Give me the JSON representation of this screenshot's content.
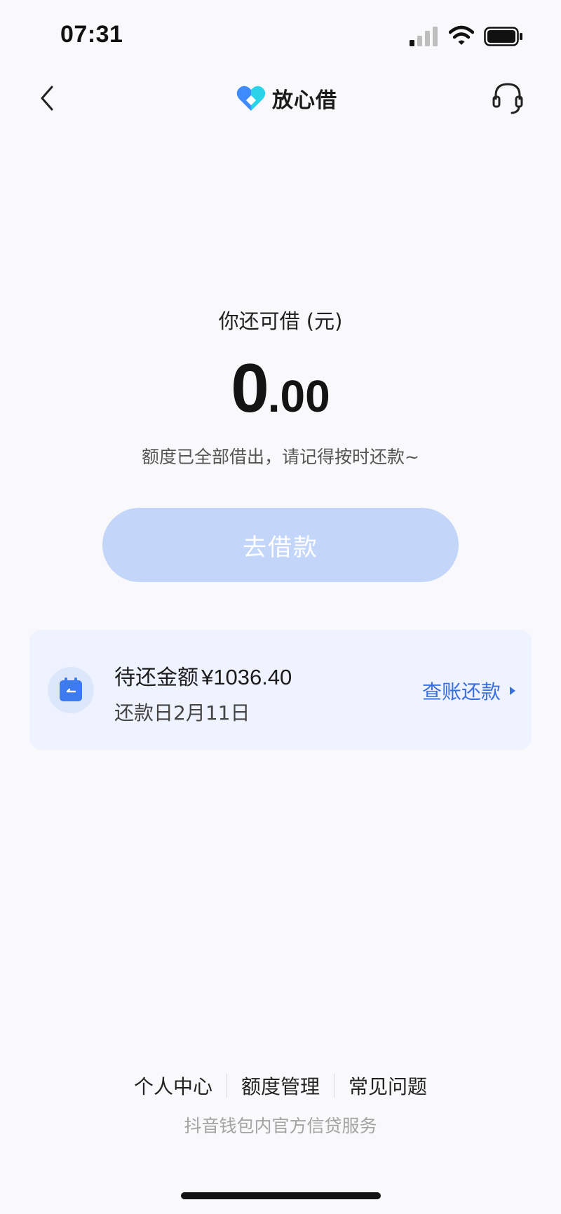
{
  "status_bar": {
    "time": "07:31",
    "icons": [
      "signal-icon",
      "wifi-icon",
      "battery-icon"
    ]
  },
  "nav": {
    "back_icon": "chevron-left-icon",
    "brand_name": "放心借",
    "service_icon": "headset-icon"
  },
  "main": {
    "available_label": "你还可借 (元)",
    "available_integer": "0",
    "available_decimal": ".00",
    "hint": "额度已全部借出，请记得按时还款~",
    "borrow_button": "去借款"
  },
  "repay": {
    "title": "待还金额",
    "amount": "¥1036.40",
    "due_date": "还款日2月11日",
    "link": "查账还款",
    "icon": "calendar-icon"
  },
  "footer": {
    "links": [
      "个人中心",
      "额度管理",
      "常见问题"
    ],
    "note": "抖音钱包内官方信贷服务"
  },
  "colors": {
    "accent": "#3a6fe0",
    "button_disabled": "#c3d6fa",
    "card_bg": "#eef3ff",
    "page_bg": "#f9f9fb",
    "logo_blue": "#3d8bfd",
    "logo_cyan": "#2ad3e8"
  }
}
